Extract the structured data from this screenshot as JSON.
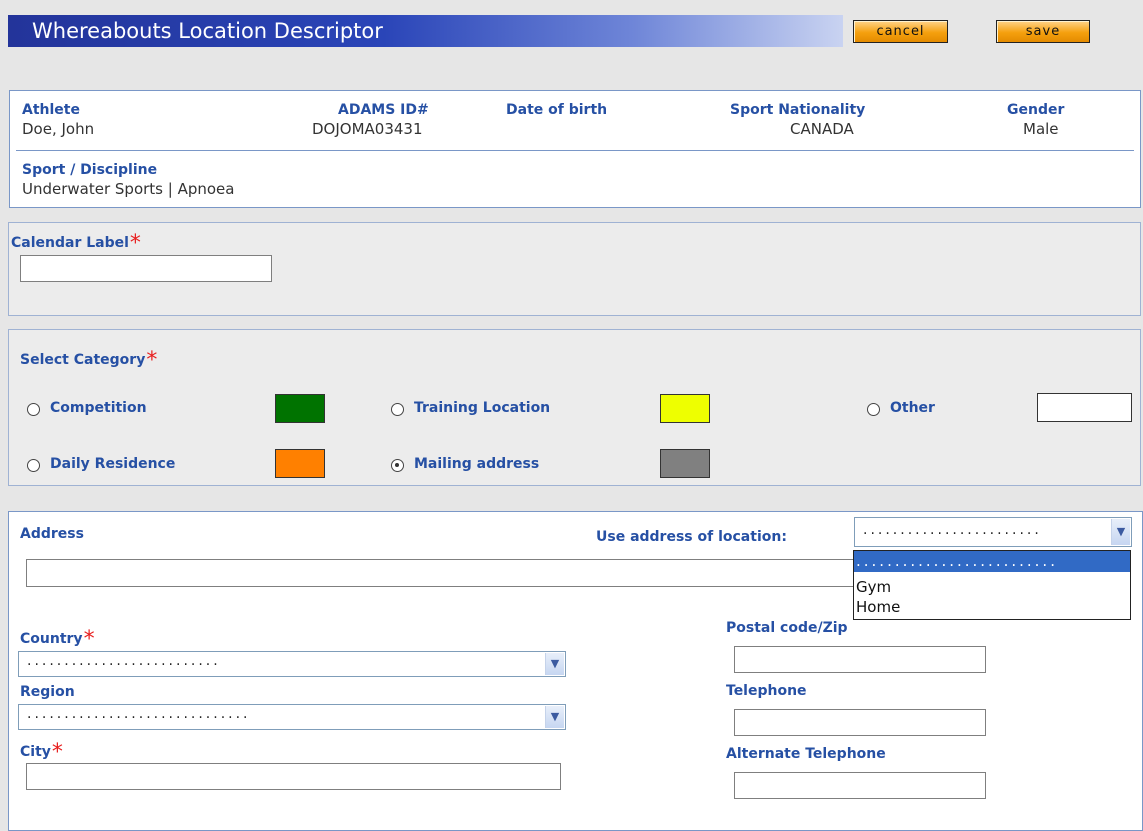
{
  "header": {
    "title": "Whereabouts Location Descriptor",
    "cancel_label": "cancel",
    "save_label": "save"
  },
  "athlete": {
    "athlete_label": "Athlete",
    "athlete_value": "Doe, John",
    "adams_label": "ADAMS ID#",
    "adams_value": "DOJOMA03431",
    "dob_label": "Date of birth",
    "dob_value": "",
    "nationality_label": "Sport Nationality",
    "nationality_value": "CANADA",
    "gender_label": "Gender",
    "gender_value": "Male",
    "sport_label": "Sport / Discipline",
    "sport_value": "Underwater Sports | Apnoea"
  },
  "calendar": {
    "label": "Calendar Label",
    "required_mark": "*",
    "value": ""
  },
  "category": {
    "label": "Select Category",
    "required_mark": "*",
    "options": [
      {
        "label": "Competition",
        "color": "#007300",
        "selected": false
      },
      {
        "label": "Training Location",
        "color": "#eeff00",
        "selected": false
      },
      {
        "label": "Other",
        "color": "#ffffff",
        "selected": false
      },
      {
        "label": "Daily Residence",
        "color": "#ff8000",
        "selected": false
      },
      {
        "label": "Mailing address",
        "color": "#808080",
        "selected": true
      }
    ]
  },
  "address": {
    "label": "Address",
    "use_location_label": "Use address of location:",
    "use_location_value": "........................",
    "use_location_options": [
      "..........................",
      "Gym",
      "Home"
    ],
    "country_label": "Country",
    "country_value": "..........................",
    "region_label": "Region",
    "region_value": "..............................",
    "city_label": "City",
    "postal_label": "Postal code/Zip",
    "telephone_label": "Telephone",
    "alt_telephone_label": "Alternate Telephone"
  }
}
